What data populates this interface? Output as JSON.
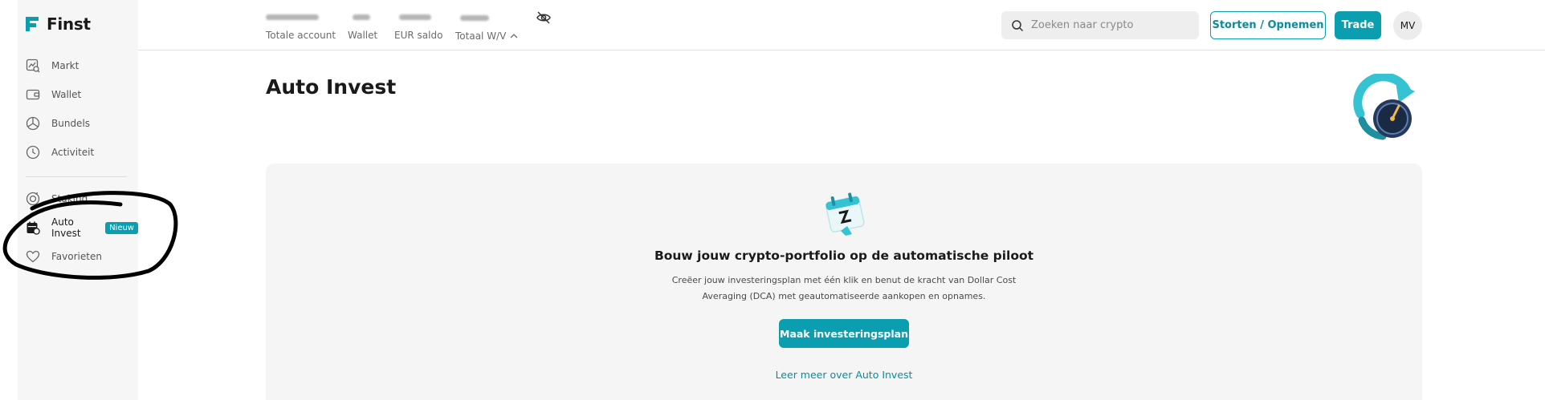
{
  "app": {
    "name": "Finst"
  },
  "sidebar": {
    "items": [
      {
        "label": "Markt",
        "icon": "market-search-icon"
      },
      {
        "label": "Wallet",
        "icon": "wallet-icon"
      },
      {
        "label": "Bundels",
        "icon": "bundles-icon"
      },
      {
        "label": "Activiteit",
        "icon": "clock-icon"
      },
      {
        "label": "Staking",
        "icon": "staking-icon"
      },
      {
        "label": "Auto Invest",
        "icon": "calendar-icon",
        "badge": "Nieuw",
        "active": true
      },
      {
        "label": "Favorieten",
        "icon": "heart-icon"
      }
    ]
  },
  "topbar": {
    "stats": [
      {
        "label": "Totale account"
      },
      {
        "label": "Wallet"
      },
      {
        "label": "EUR saldo"
      },
      {
        "label": "Totaal W/V"
      }
    ],
    "search_placeholder": "Zoeken naar crypto",
    "deposit_label": "Storten / Opnemen",
    "trade_label": "Trade",
    "avatar_initials": "MV"
  },
  "main": {
    "title": "Auto Invest",
    "card": {
      "heading": "Bouw jouw crypto-portfolio op de automatische piloot",
      "description": "Creëer jouw investeringsplan met één klik en benut de kracht van Dollar Cost Averaging (DCA) met geautomatiseerde aankopen en opnames.",
      "button_label": "Maak investeringsplan",
      "link_label": "Leer meer over Auto Invest"
    }
  },
  "colors": {
    "accent": "#0a9eb0",
    "sidebar_bg": "#f6f6f6",
    "card_bg": "#f5f5f5"
  }
}
